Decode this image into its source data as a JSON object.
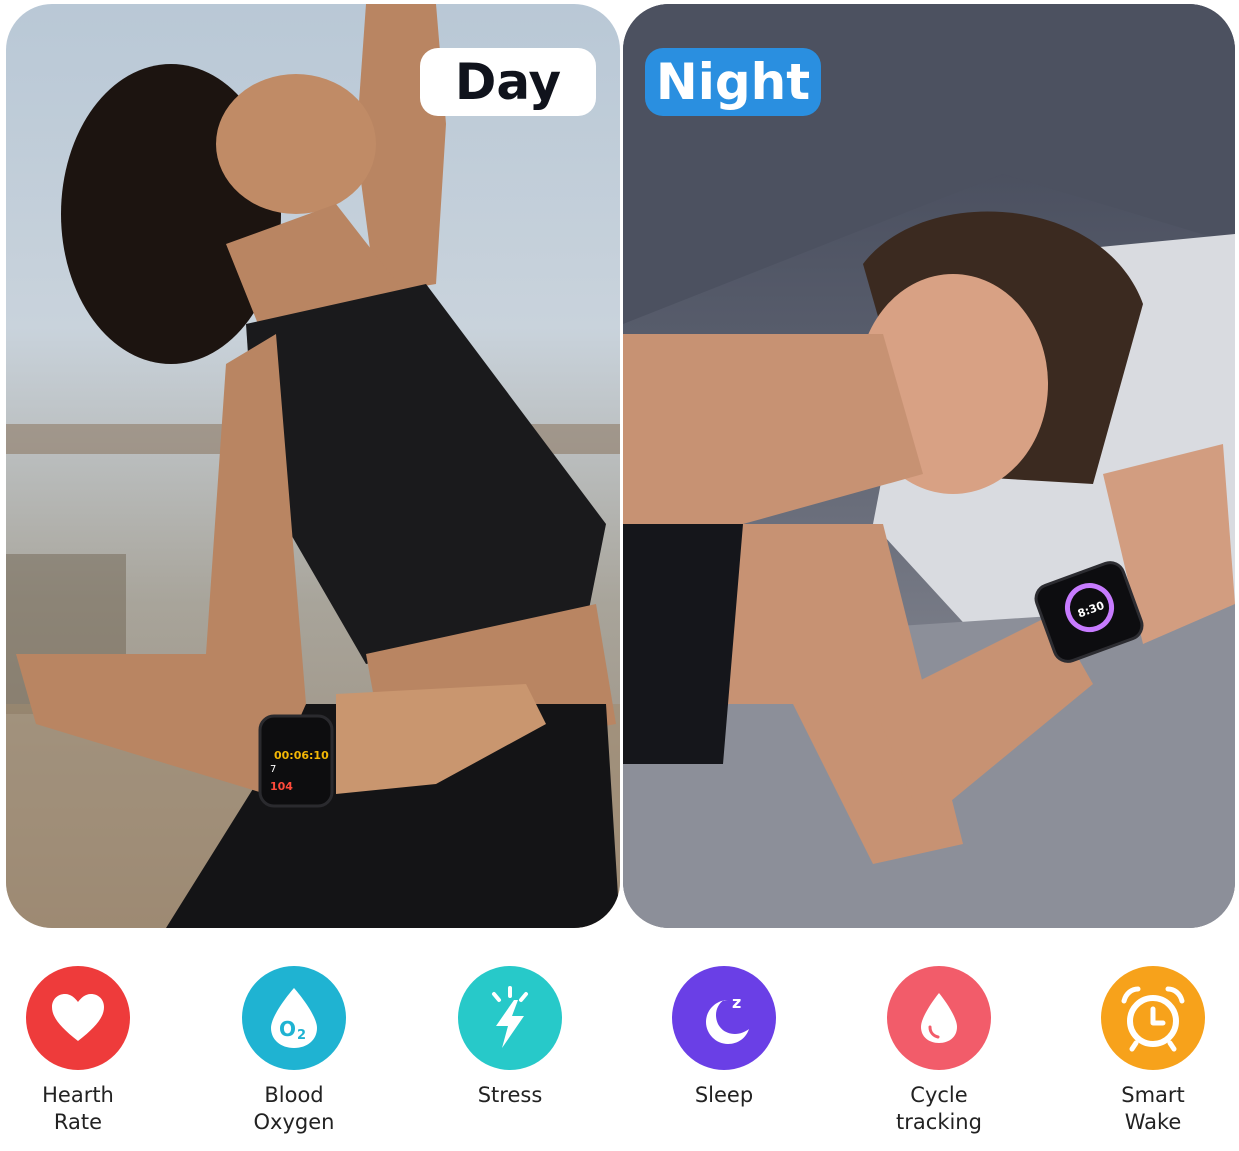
{
  "badges": {
    "day": "Day",
    "night": "Night"
  },
  "watch_day": {
    "time": "00:06:10",
    "kcal": "7",
    "bpm": "104"
  },
  "watch_night": {
    "time": "8:30"
  },
  "features": [
    {
      "line1": "Hearth",
      "line2": "Rate",
      "icon": "heart-icon",
      "color": "#ee3b3b"
    },
    {
      "line1": "Blood",
      "line2": "Oxygen",
      "icon": "o2-drop-icon",
      "color": "#1fb3d2"
    },
    {
      "line1": "Stress",
      "line2": "",
      "icon": "lightning-icon",
      "color": "#27c9c9"
    },
    {
      "line1": "Sleep",
      "line2": "",
      "icon": "moon-icon",
      "color": "#6a3fe6"
    },
    {
      "line1": "Cycle",
      "line2": "tracking",
      "icon": "drop-icon",
      "color": "#f25c6a"
    },
    {
      "line1": "Smart",
      "line2": "Wake",
      "icon": "alarm-clock-icon",
      "color": "#f7a21b"
    }
  ]
}
